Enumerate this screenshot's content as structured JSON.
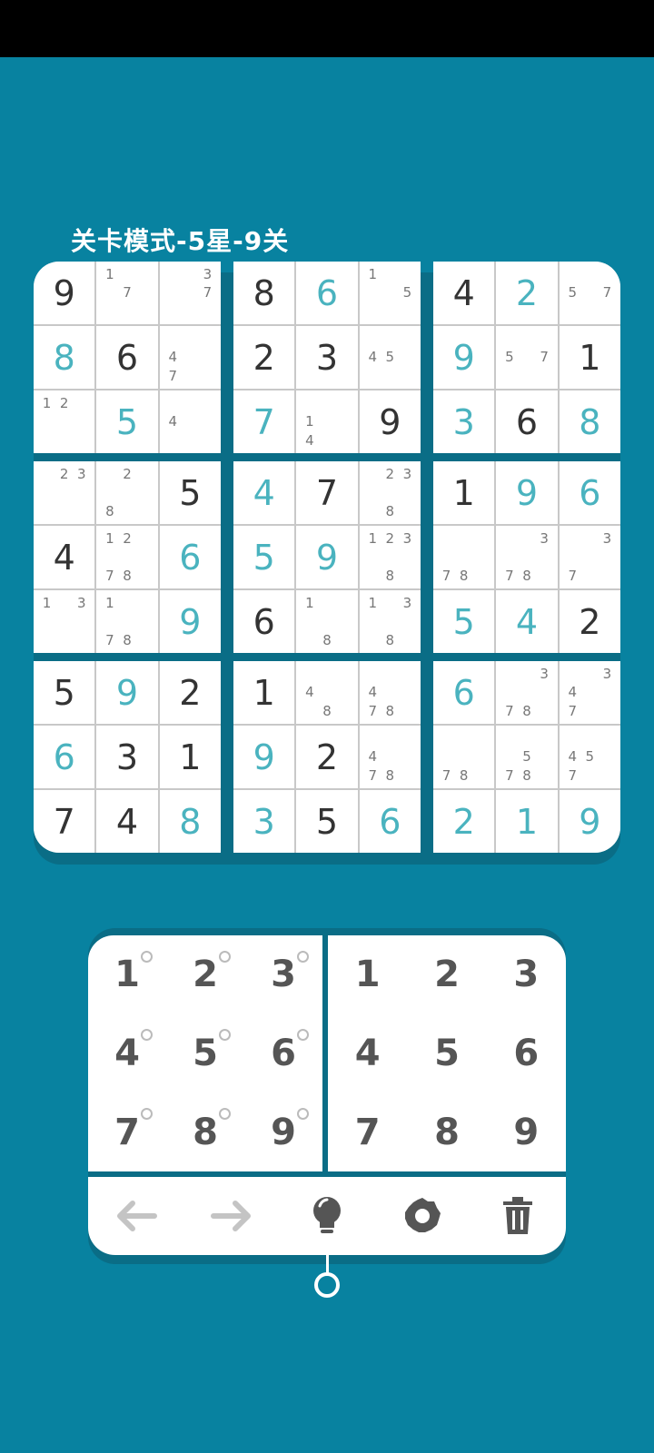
{
  "level_title": "关卡模式-5星-9关",
  "colors": {
    "background": "#0882a0",
    "given_digit": "#333333",
    "entered_digit": "#4ab3bf",
    "note_digit": "#777777"
  },
  "grid": [
    [
      {
        "v": "9",
        "t": "g"
      },
      {
        "n": "1   7  "
      },
      {
        "n": "  3  7  "
      },
      {
        "v": "8",
        "t": "g"
      },
      {
        "v": "6",
        "t": "e"
      },
      {
        "n": "1    5"
      },
      {
        "v": "4",
        "t": "g"
      },
      {
        "v": "2",
        "t": "e"
      },
      {
        "n": "   5 7"
      }
    ],
    [
      {
        "v": "8",
        "t": "e"
      },
      {
        "v": "6",
        "t": "g"
      },
      {
        "n": "   4  7"
      },
      {
        "v": "2",
        "t": "g"
      },
      {
        "v": "3",
        "t": "g"
      },
      {
        "n": "   45"
      },
      {
        "v": "9",
        "t": "e"
      },
      {
        "n": "   5 7"
      },
      {
        "v": "1",
        "t": "g"
      }
    ],
    [
      {
        "n": "12"
      },
      {
        "v": "5",
        "t": "e"
      },
      {
        "n": "   4"
      },
      {
        "v": "7",
        "t": "e"
      },
      {
        "n": "   1  4"
      },
      {
        "v": "9",
        "t": "g"
      },
      {
        "v": "3",
        "t": "e"
      },
      {
        "v": "6",
        "t": "g"
      },
      {
        "v": "8",
        "t": "e"
      }
    ],
    [
      {
        "n": " 23"
      },
      {
        "n": " 2    8 "
      },
      {
        "v": "5",
        "t": "g"
      },
      {
        "v": "4",
        "t": "e"
      },
      {
        "v": "7",
        "t": "g"
      },
      {
        "n": " 23    8 "
      },
      {
        "v": "1",
        "t": "g"
      },
      {
        "v": "9",
        "t": "e"
      },
      {
        "v": "6",
        "t": "e"
      }
    ],
    [
      {
        "v": "4",
        "t": "g"
      },
      {
        "n": "12    78 "
      },
      {
        "v": "6",
        "t": "e"
      },
      {
        "v": "5",
        "t": "e"
      },
      {
        "v": "9",
        "t": "e"
      },
      {
        "n": "123    8 "
      },
      {
        "n": "      78 "
      },
      {
        "n": "  3   78 "
      },
      {
        "n": "  3   7  "
      }
    ],
    [
      {
        "n": "1 3"
      },
      {
        "n": "1     78"
      },
      {
        "v": "9",
        "t": "e"
      },
      {
        "v": "6",
        "t": "g"
      },
      {
        "n": "1      8 "
      },
      {
        "n": "1 3    8 "
      },
      {
        "v": "5",
        "t": "e"
      },
      {
        "v": "4",
        "t": "e"
      },
      {
        "v": "2",
        "t": "g"
      }
    ],
    [
      {
        "v": "5",
        "t": "g"
      },
      {
        "v": "9",
        "t": "e"
      },
      {
        "v": "2",
        "t": "g"
      },
      {
        "v": "1",
        "t": "g"
      },
      {
        "n": "   4   8 "
      },
      {
        "n": "   4  78"
      },
      {
        "v": "6",
        "t": "e"
      },
      {
        "n": "  3   78 "
      },
      {
        "n": "  34  7  "
      }
    ],
    [
      {
        "v": "6",
        "t": "e"
      },
      {
        "v": "3",
        "t": "g"
      },
      {
        "v": "1",
        "t": "g"
      },
      {
        "v": "9",
        "t": "e"
      },
      {
        "v": "2",
        "t": "g"
      },
      {
        "n": "   4  78"
      },
      {
        "n": "      78 "
      },
      {
        "n": "    5 78 "
      },
      {
        "n": "   45 7  "
      }
    ],
    [
      {
        "v": "7",
        "t": "g"
      },
      {
        "v": "4",
        "t": "g"
      },
      {
        "v": "8",
        "t": "e"
      },
      {
        "v": "3",
        "t": "e"
      },
      {
        "v": "5",
        "t": "g"
      },
      {
        "v": "6",
        "t": "e"
      },
      {
        "v": "2",
        "t": "e"
      },
      {
        "v": "1",
        "t": "e"
      },
      {
        "v": "9",
        "t": "e"
      }
    ]
  ],
  "notes_pad": [
    "1",
    "2",
    "3",
    "4",
    "5",
    "6",
    "7",
    "8",
    "9"
  ],
  "number_pad": [
    "1",
    "2",
    "3",
    "4",
    "5",
    "6",
    "7",
    "8",
    "9"
  ],
  "toolbar": [
    {
      "name": "undo-arrow-icon"
    },
    {
      "name": "redo-arrow-icon"
    },
    {
      "name": "hint-bulb-icon"
    },
    {
      "name": "settings-gear-icon"
    },
    {
      "name": "delete-trash-icon"
    }
  ]
}
